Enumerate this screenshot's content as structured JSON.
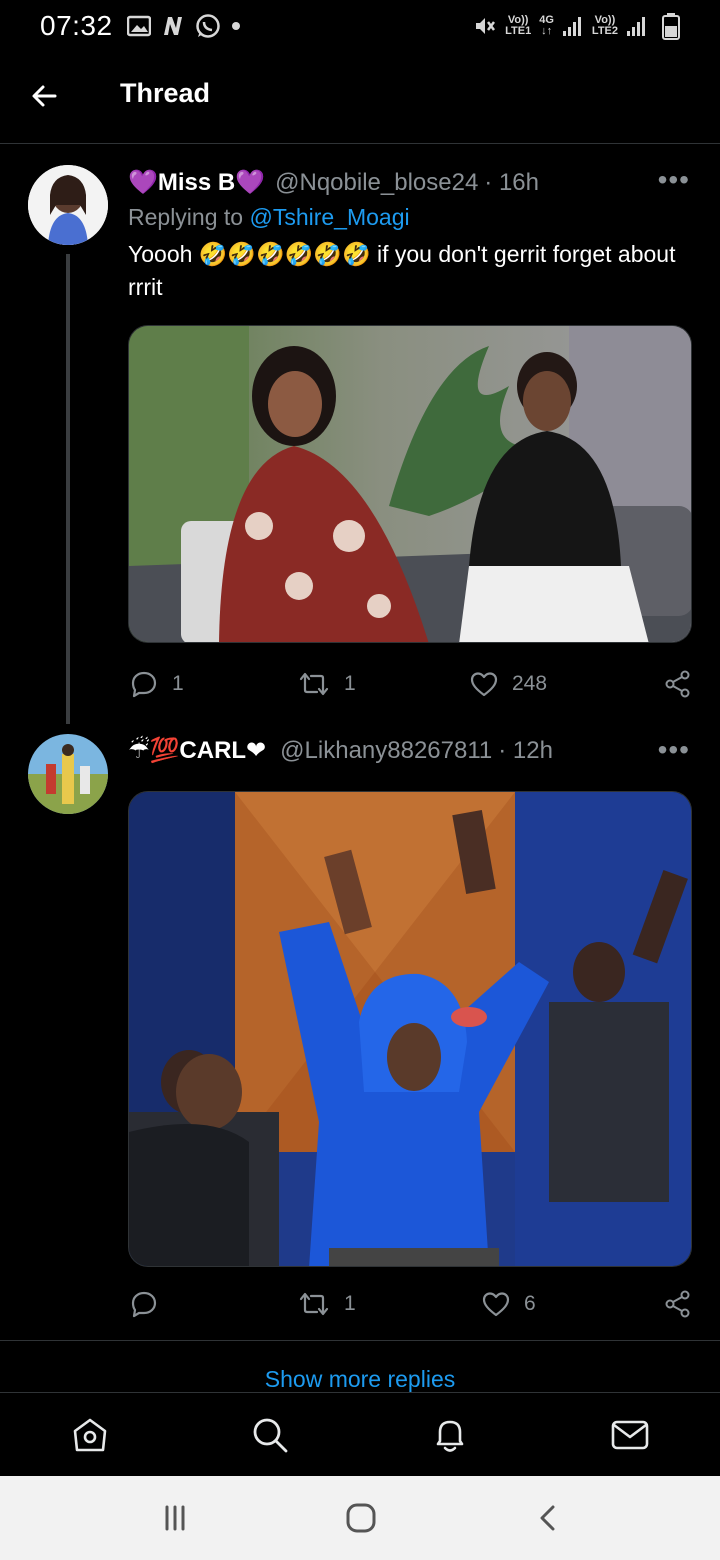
{
  "status_bar": {
    "time": "07:32",
    "left_icons": [
      "image-icon",
      "n-app-icon",
      "whatsapp-icon",
      "dot-icon"
    ],
    "sim1_label_top": "Vo))",
    "sim1_label_bottom": "LTE1",
    "network": "4G",
    "sim2_label_top": "Vo))",
    "sim2_label_bottom": "LTE2"
  },
  "header": {
    "title": "Thread",
    "back_icon": "arrow-left-icon"
  },
  "tweets": [
    {
      "name": "💜Miss B💜",
      "handle": "@Nqobile_blose24",
      "time": "· 16h",
      "replying_prefix": "Replying to",
      "replying_to": "@Tshire_Moagi",
      "text": "Yoooh 🤣🤣🤣🤣🤣🤣 if you don't gerrit forget about rrrit",
      "replies": "1",
      "retweets": "1",
      "likes": "248"
    },
    {
      "name": "☔💯CARL❤",
      "handle": "@Likhany88267811",
      "time": "· 12h",
      "replies": "",
      "retweets": "1",
      "likes": "6"
    }
  ],
  "show_more": "Show more replies",
  "tabs": [
    "home-icon",
    "search-icon",
    "notifications-icon",
    "messages-icon"
  ],
  "system_nav": [
    "recent-apps-icon",
    "home-circle-icon",
    "back-chevron-icon"
  ],
  "colors": {
    "background": "#000000",
    "accent": "#1d9bf0",
    "muted": "#8b9196",
    "divider": "#2f3336"
  }
}
